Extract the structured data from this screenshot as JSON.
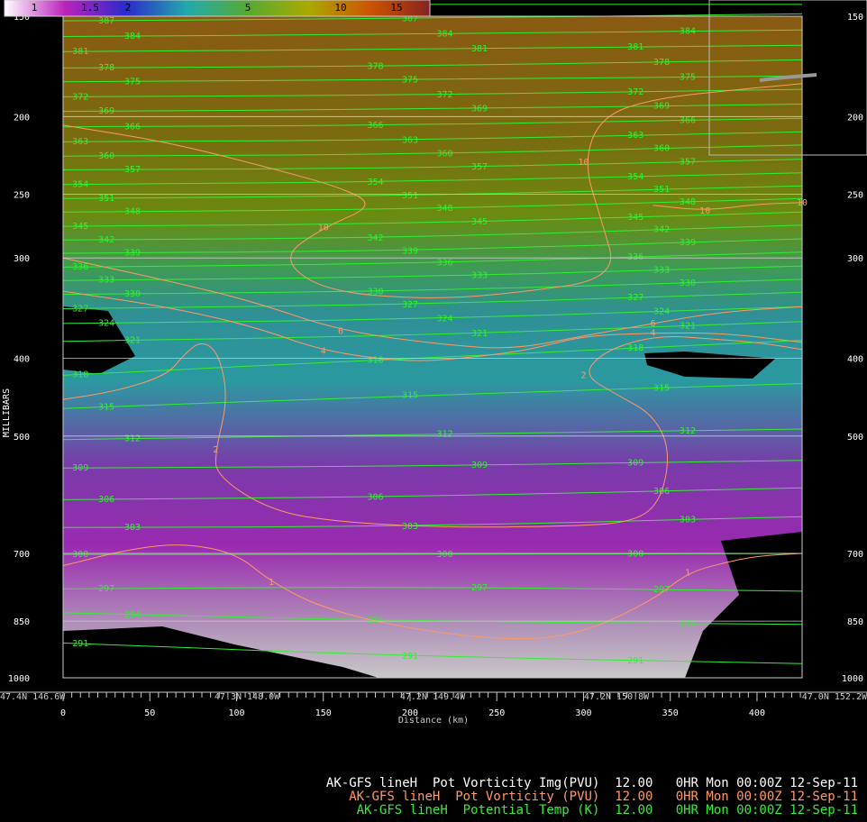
{
  "chart_data": {
    "type": "heatmap",
    "colorbar": {
      "ticks": [
        "1",
        "1.5",
        "2",
        "5",
        "10",
        "15"
      ],
      "stops": [
        "#ffffff",
        "#bb22bb",
        "#2a2acc",
        "#22aaaa",
        "#55aa33",
        "#aaaa00",
        "#cc5500",
        "#882222"
      ]
    },
    "yaxis": {
      "label": "MILLIBARS",
      "ticks": [
        150,
        200,
        250,
        300,
        400,
        500,
        700,
        850,
        1000
      ],
      "ylim": [
        1000,
        150
      ],
      "scale": "log-pressure"
    },
    "xaxis": {
      "label": "Distance (km)",
      "ticks": [
        0,
        50,
        100,
        150,
        200,
        250,
        300,
        350,
        400
      ],
      "xlim": [
        0,
        426
      ],
      "location_labels": [
        {
          "text": "47.4N 146.6W",
          "km": 0
        },
        {
          "text": "47.3N 148.0W",
          "km": 106
        },
        {
          "text": "47.2N 149.4W",
          "km": 213
        },
        {
          "text": "47.2N 150.8W",
          "km": 319
        },
        {
          "text": "47.0N 152.2W",
          "km": 426
        }
      ]
    },
    "theta_series": [
      {
        "k": 390,
        "pts": [
          [
            0,
            145
          ],
          [
            426,
            145
          ]
        ]
      },
      {
        "k": 387,
        "pts": [
          [
            0,
            152
          ],
          [
            200,
            151
          ],
          [
            426,
            149
          ]
        ]
      },
      {
        "k": 384,
        "pts": [
          [
            0,
            159
          ],
          [
            200,
            158
          ],
          [
            426,
            156
          ]
        ]
      },
      {
        "k": 381,
        "pts": [
          [
            0,
            166
          ],
          [
            200,
            165
          ],
          [
            426,
            163
          ]
        ]
      },
      {
        "k": 378,
        "pts": [
          [
            0,
            174
          ],
          [
            200,
            173
          ],
          [
            426,
            170
          ]
        ]
      },
      {
        "k": 375,
        "pts": [
          [
            0,
            181
          ],
          [
            200,
            180
          ],
          [
            426,
            178
          ]
        ]
      },
      {
        "k": 372,
        "pts": [
          [
            0,
            189
          ],
          [
            200,
            188
          ],
          [
            426,
            185
          ]
        ]
      },
      {
        "k": 369,
        "pts": [
          [
            0,
            197
          ],
          [
            200,
            196
          ],
          [
            426,
            193
          ]
        ]
      },
      {
        "k": 366,
        "pts": [
          [
            0,
            206
          ],
          [
            200,
            205
          ],
          [
            426,
            201
          ]
        ]
      },
      {
        "k": 363,
        "pts": [
          [
            0,
            215
          ],
          [
            200,
            214
          ],
          [
            426,
            209
          ]
        ]
      },
      {
        "k": 360,
        "pts": [
          [
            0,
            224
          ],
          [
            200,
            223
          ],
          [
            426,
            217
          ]
        ]
      },
      {
        "k": 357,
        "pts": [
          [
            0,
            233
          ],
          [
            200,
            232
          ],
          [
            426,
            226
          ]
        ]
      },
      {
        "k": 354,
        "pts": [
          [
            0,
            243
          ],
          [
            200,
            241
          ],
          [
            426,
            235
          ]
        ]
      },
      {
        "k": 351,
        "pts": [
          [
            0,
            253
          ],
          [
            200,
            251
          ],
          [
            426,
            244
          ]
        ]
      },
      {
        "k": 348,
        "pts": [
          [
            0,
            263
          ],
          [
            200,
            261
          ],
          [
            426,
            253
          ]
        ]
      },
      {
        "k": 345,
        "pts": [
          [
            0,
            274
          ],
          [
            200,
            272
          ],
          [
            426,
            263
          ]
        ]
      },
      {
        "k": 342,
        "pts": [
          [
            0,
            285
          ],
          [
            200,
            283
          ],
          [
            426,
            273
          ]
        ]
      },
      {
        "k": 339,
        "pts": [
          [
            0,
            296
          ],
          [
            200,
            294
          ],
          [
            426,
            284
          ]
        ]
      },
      {
        "k": 336,
        "pts": [
          [
            0,
            308
          ],
          [
            200,
            305
          ],
          [
            426,
            295
          ]
        ]
      },
      {
        "k": 333,
        "pts": [
          [
            0,
            320
          ],
          [
            200,
            317
          ],
          [
            426,
            307
          ]
        ]
      },
      {
        "k": 330,
        "pts": [
          [
            0,
            333
          ],
          [
            200,
            330
          ],
          [
            426,
            319
          ]
        ]
      },
      {
        "k": 327,
        "pts": [
          [
            0,
            347
          ],
          [
            200,
            343
          ],
          [
            426,
            331
          ]
        ]
      },
      {
        "k": 324,
        "pts": [
          [
            0,
            362
          ],
          [
            200,
            358
          ],
          [
            426,
            345
          ]
        ]
      },
      {
        "k": 321,
        "pts": [
          [
            0,
            381
          ],
          [
            200,
            375
          ],
          [
            426,
            360
          ]
        ]
      },
      {
        "k": 318,
        "pts": [
          [
            0,
            420
          ],
          [
            200,
            400
          ],
          [
            426,
            380
          ]
        ]
      },
      {
        "k": 315,
        "pts": [
          [
            0,
            462
          ],
          [
            200,
            445
          ],
          [
            426,
            430
          ]
        ]
      },
      {
        "k": 312,
        "pts": [
          [
            0,
            505
          ],
          [
            200,
            498
          ],
          [
            426,
            490
          ]
        ]
      },
      {
        "k": 309,
        "pts": [
          [
            0,
            548
          ],
          [
            200,
            545
          ],
          [
            426,
            536
          ]
        ]
      },
      {
        "k": 306,
        "pts": [
          [
            0,
            600
          ],
          [
            200,
            595
          ],
          [
            426,
            580
          ]
        ]
      },
      {
        "k": 303,
        "pts": [
          [
            0,
            650
          ],
          [
            200,
            648
          ],
          [
            426,
            630
          ]
        ]
      },
      {
        "k": 300,
        "pts": [
          [
            0,
            702
          ],
          [
            200,
            702
          ],
          [
            426,
            700
          ]
        ]
      },
      {
        "k": 297,
        "pts": [
          [
            0,
            775
          ],
          [
            200,
            770
          ],
          [
            426,
            780
          ]
        ]
      },
      {
        "k": 294,
        "pts": [
          [
            0,
            830
          ],
          [
            200,
            850
          ],
          [
            426,
            858
          ]
        ]
      },
      {
        "k": 291,
        "pts": [
          [
            0,
            905
          ],
          [
            200,
            940
          ],
          [
            426,
            960
          ]
        ]
      }
    ],
    "pv_contours": [
      {
        "v": "10",
        "pts": [
          [
            0,
            205
          ],
          [
            60,
            215
          ],
          [
            120,
            232
          ],
          [
            160,
            245
          ],
          [
            180,
            258
          ],
          [
            150,
            275
          ],
          [
            125,
            300
          ],
          [
            150,
            330
          ],
          [
            210,
            338
          ],
          [
            260,
            332
          ],
          [
            320,
            318
          ],
          [
            310,
            268
          ],
          [
            300,
            228
          ],
          [
            310,
            200
          ],
          [
            340,
            190
          ],
          [
            390,
            185
          ],
          [
            426,
            182
          ]
        ]
      },
      {
        "v": "10",
        "pts": [
          [
            340,
            258
          ],
          [
            370,
            262
          ],
          [
            400,
            257
          ],
          [
            426,
            256
          ]
        ]
      },
      {
        "v": "6",
        "pts": [
          [
            0,
            300
          ],
          [
            60,
            320
          ],
          [
            110,
            340
          ],
          [
            160,
            370
          ],
          [
            220,
            385
          ],
          [
            260,
            390
          ],
          [
            300,
            375
          ],
          [
            340,
            362
          ],
          [
            380,
            350
          ],
          [
            426,
            345
          ]
        ]
      },
      {
        "v": "4",
        "pts": [
          [
            0,
            330
          ],
          [
            60,
            345
          ],
          [
            110,
            365
          ],
          [
            150,
            392
          ],
          [
            200,
            405
          ],
          [
            240,
            398
          ],
          [
            270,
            390
          ],
          [
            300,
            375
          ],
          [
            340,
            372
          ],
          [
            380,
            372
          ],
          [
            426,
            382
          ]
        ]
      },
      {
        "v": "2",
        "pts": [
          [
            0,
            450
          ],
          [
            30,
            440
          ],
          [
            60,
            420
          ],
          [
            70,
            395
          ],
          [
            80,
            380
          ],
          [
            90,
            395
          ],
          [
            95,
            450
          ],
          [
            88,
            520
          ],
          [
            88,
            560
          ],
          [
            120,
            620
          ],
          [
            160,
            640
          ],
          [
            220,
            650
          ],
          [
            290,
            648
          ],
          [
            330,
            640
          ],
          [
            345,
            600
          ],
          [
            350,
            520
          ],
          [
            340,
            470
          ],
          [
            320,
            445
          ],
          [
            300,
            420
          ],
          [
            310,
            395
          ],
          [
            330,
            380
          ],
          [
            350,
            375
          ],
          [
            370,
            378
          ],
          [
            400,
            382
          ],
          [
            426,
            390
          ]
        ]
      },
      {
        "v": "1",
        "pts": [
          [
            0,
            725
          ],
          [
            40,
            690
          ],
          [
            70,
            680
          ],
          [
            100,
            700
          ],
          [
            120,
            760
          ],
          [
            150,
            820
          ],
          [
            200,
            870
          ],
          [
            260,
            900
          ],
          [
            300,
            880
          ],
          [
            340,
            800
          ],
          [
            360,
            740
          ],
          [
            380,
            720
          ],
          [
            400,
            705
          ],
          [
            426,
            700
          ]
        ]
      }
    ]
  },
  "legend": {
    "lines": [
      {
        "model": "AK-GFS",
        "line": "lineH",
        "field": "Pot Vorticity Img(PVU)",
        "level": "12.00",
        "fhr": "0HR",
        "time": "Mon 00:00Z 12-Sep-11",
        "color": "#ffffff"
      },
      {
        "model": "AK-GFS",
        "line": "lineH",
        "field": "Pot Vorticity (PVU)",
        "level": "12.00",
        "fhr": "0HR",
        "time": "Mon 00:00Z 12-Sep-11",
        "color": "#ff9966"
      },
      {
        "model": "AK-GFS",
        "line": "lineH",
        "field": "Potential Temp (K)",
        "level": "12.00",
        "fhr": "0HR",
        "time": "Mon 00:00Z 12-Sep-11",
        "color": "#33ee33"
      }
    ]
  }
}
